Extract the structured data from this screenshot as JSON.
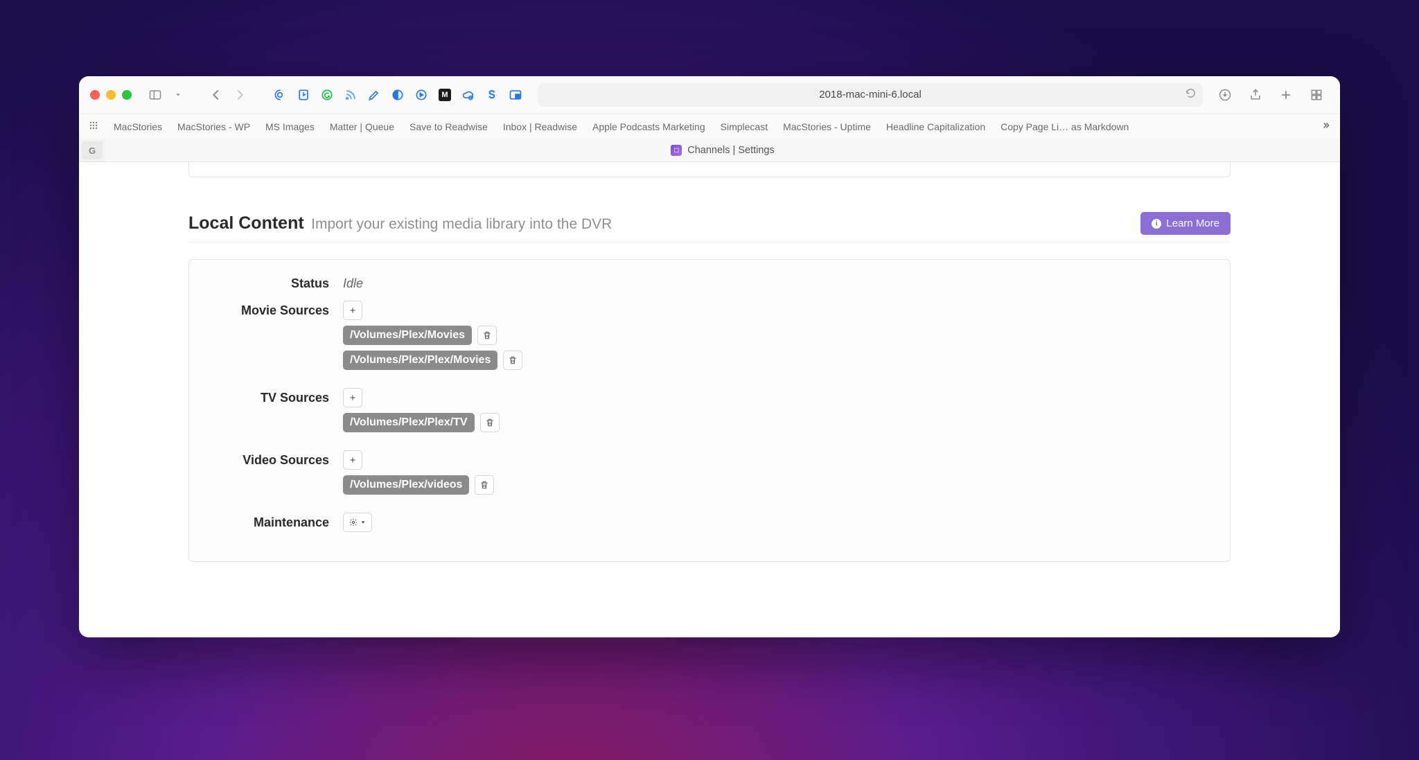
{
  "browser": {
    "address": "2018-mac-mini-6.local",
    "bookmarks": [
      "MacStories",
      "MacStories - WP",
      "MS Images",
      "Matter | Queue",
      "Save to Readwise",
      "Inbox | Readwise",
      "Apple Podcasts Marketing",
      "Simplecast",
      "MacStories - Uptime",
      "Headline Capitalization",
      "Copy Page Li… as Markdown"
    ],
    "side_badge": "G",
    "tab_title": "Channels | Settings"
  },
  "page": {
    "section_title": "Local Content",
    "section_subtitle": "Import your existing media library into the DVR",
    "learn_more": "Learn More",
    "rows": {
      "status_label": "Status",
      "status_value": "Idle",
      "movie_label": "Movie Sources",
      "movie_paths": [
        "/Volumes/Plex/Movies",
        "/Volumes/Plex/Plex/Movies"
      ],
      "tv_label": "TV Sources",
      "tv_paths": [
        "/Volumes/Plex/Plex/TV"
      ],
      "video_label": "Video Sources",
      "video_paths": [
        "/Volumes/Plex/videos"
      ],
      "maint_label": "Maintenance"
    }
  }
}
